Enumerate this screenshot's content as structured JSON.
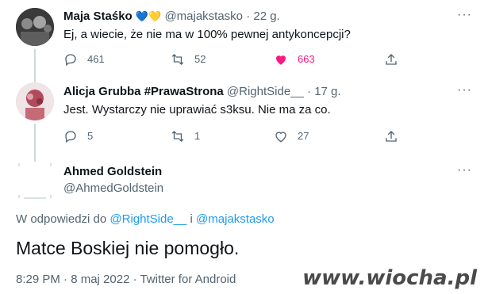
{
  "tweets": [
    {
      "name": "Maja Staśko",
      "emoji": "💙💛",
      "handle": "@majakstasko",
      "time": "· 22 g.",
      "text": "Ej, a wiecie, że nie ma w 100% pewnej antykoncepcji?",
      "replies": "461",
      "retweets": "52",
      "likes": "663",
      "like_color": "#f91880",
      "more": "···"
    },
    {
      "name": "Alicja Grubba #PrawaStrona",
      "handle": "@RightSide__",
      "time": "· 17 g.",
      "text": "Jest. Wystarczy nie uprawiać s3ksu. Nie ma za co.",
      "replies": "5",
      "retweets": "1",
      "likes": "27",
      "more": "···"
    }
  ],
  "main_tweet": {
    "name": "Ahmed Goldstein",
    "handle": "@AhmedGoldstein",
    "more": "···",
    "reply_prefix": "W odpowiedzi do",
    "reply_to_1": "@RightSide__",
    "reply_joiner": "i",
    "reply_to_2": "@majakstasko",
    "text": "Matce Boskiej nie pomogło.",
    "timestamp": "8:29 PM · 8 maj 2022 · Twitter for Android"
  },
  "watermark": "www.wiocha.pl",
  "colors": {
    "link": "#1d9bf0",
    "muted": "#536471",
    "like": "#f91880"
  }
}
